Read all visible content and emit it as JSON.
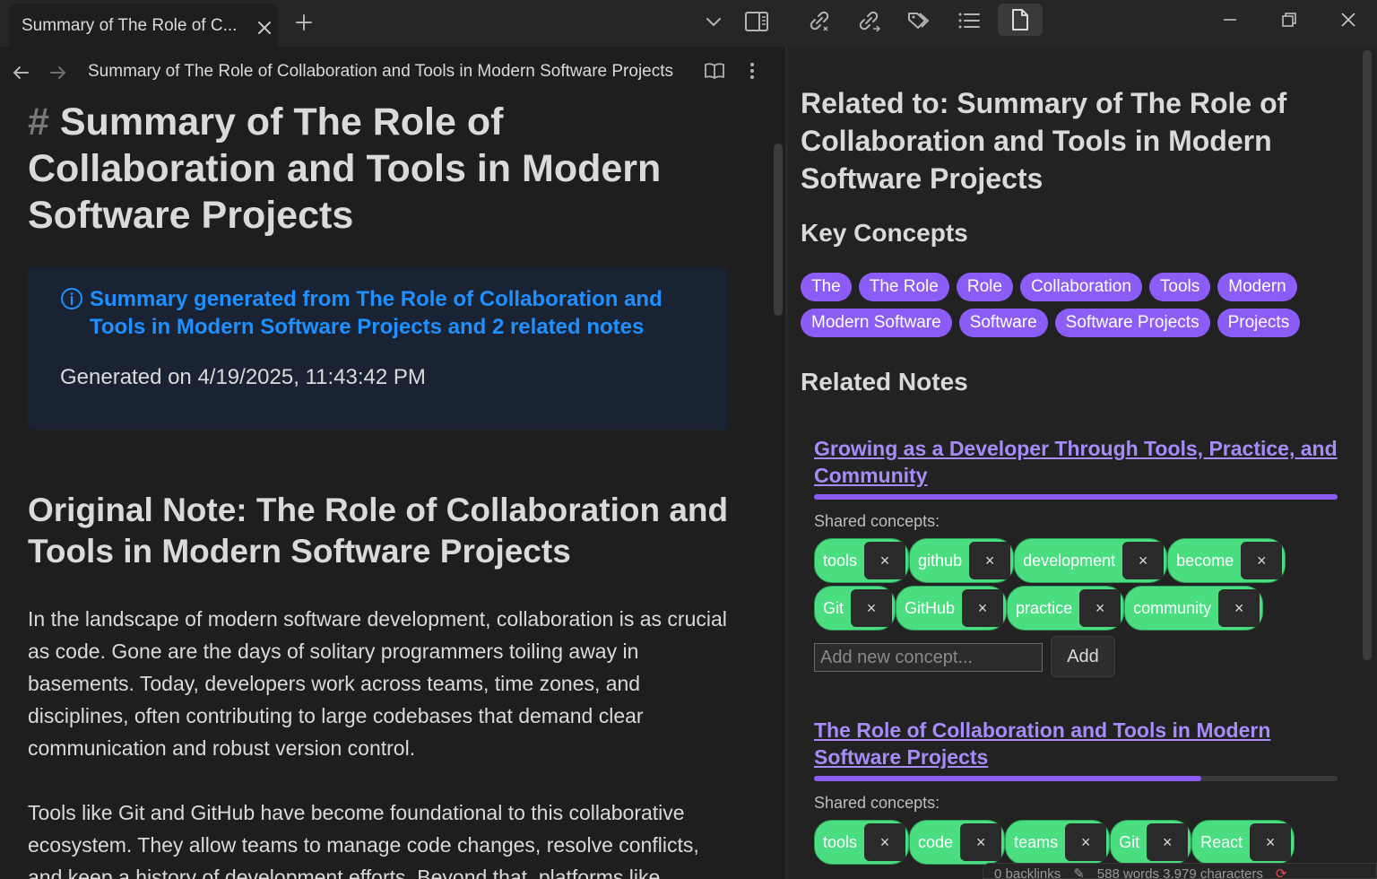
{
  "tab": {
    "title": "Summary of The Role of C..."
  },
  "toolbar": {
    "icons": [
      "close-icon",
      "plus-icon",
      "chevron-down-icon",
      "sidebar-toggle-icon",
      "link-in-icon",
      "link-out-icon",
      "tags-icon",
      "outline-icon",
      "file-icon"
    ]
  },
  "window": {
    "controls": [
      "minimize",
      "restore",
      "close"
    ]
  },
  "editor": {
    "breadcrumb": "Summary of The Role of Collaboration and Tools in Modern Software Projects",
    "heading_hash": "#",
    "title": "Summary of The Role of Collaboration and Tools in Modern Software Projects",
    "callout": {
      "title": "Summary generated from The Role of Collaboration and Tools in Modern Software Projects and 2 related notes",
      "body": "Generated on 4/19/2025, 11:43:42 PM"
    },
    "section_heading": "Original Note: The Role of Collaboration and Tools in Modern Software Projects",
    "paragraph1": "In the landscape of modern software development, collaboration is as crucial as code. Gone are the days of solitary programmers toiling away in basements. Today, developers work across teams, time zones, and disciplines, often contributing to large codebases that demand clear communication and robust version control.",
    "paragraph2": "Tools like Git and GitHub have become foundational to this collaborative ecosystem. They allow teams to manage code changes, resolve conflicts, and keep a history of development efforts. Beyond that, platforms like"
  },
  "related": {
    "title": "Related to: Summary of The Role of Collaboration and Tools in Modern Software Projects",
    "key_concepts_heading": "Key Concepts",
    "key_concepts": [
      "The",
      "The Role",
      "Role",
      "Collaboration",
      "Tools",
      "Modern",
      "Modern Software",
      "Software",
      "Software Projects",
      "Projects"
    ],
    "related_notes_heading": "Related Notes",
    "notes": [
      {
        "title": "Growing as a Developer Through Tools, Practice, and Community",
        "similarity": 1.0,
        "shared_label": "Shared concepts:",
        "concepts": [
          "tools",
          "github",
          "development",
          "become",
          "Git",
          "GitHub",
          "practice",
          "community"
        ]
      },
      {
        "title": "The Role of Collaboration and Tools in Modern Software Projects",
        "similarity": 0.74,
        "shared_label": "Shared concepts:",
        "concepts": [
          "tools",
          "code",
          "teams",
          "Git",
          "React"
        ]
      }
    ],
    "add_placeholder": "Add new concept...",
    "add_label": "Add",
    "remove_glyph": "×"
  },
  "status_bar": {
    "backlinks": "0 backlinks",
    "counts": "588 words 3,979 characters"
  },
  "colors": {
    "accent": "#8b5cf6",
    "tag_green": "#4ade80",
    "callout_blue": "#1e90ff"
  }
}
